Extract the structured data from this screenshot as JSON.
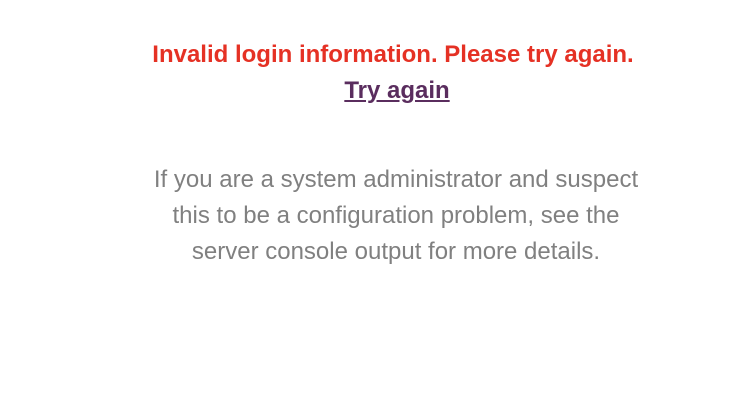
{
  "login_error": {
    "message": "Invalid login information. Please try again.",
    "retry_link": "Try again",
    "help_text": "If you are a system administrator and suspect this to be a configuration problem, see the server console output for more details."
  },
  "colors": {
    "error": "#e53124",
    "link": "#5a2d5e",
    "muted_text": "#808080",
    "background": "#ffffff"
  }
}
